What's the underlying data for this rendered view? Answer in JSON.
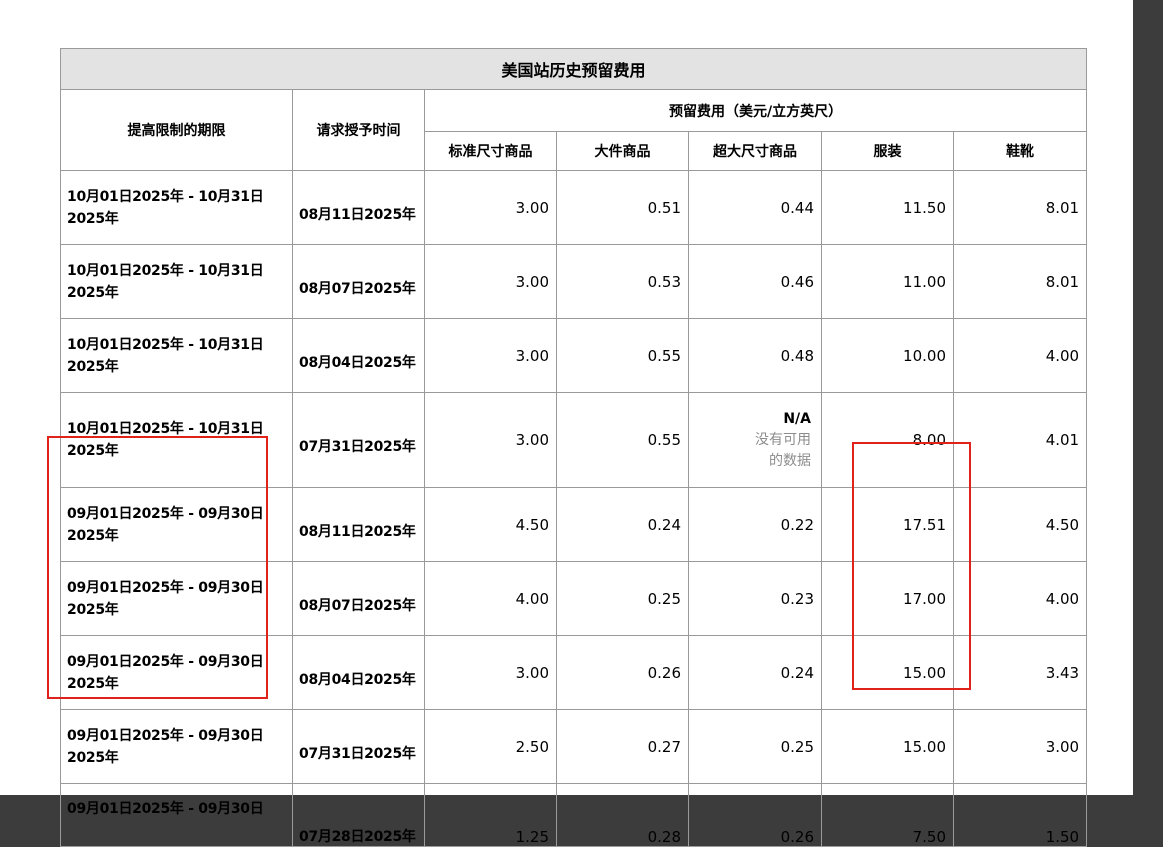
{
  "title": "美国站历史预留费用",
  "headers": {
    "period": "提高限制的期限",
    "request_time": "请求授予时间",
    "fee_group": "预留费用（美元/立方英尺）",
    "categories": [
      "标准尺寸商品",
      "大件商品",
      "超大尺寸商品",
      "服装",
      "鞋靴"
    ]
  },
  "rows": [
    {
      "period_line1": "10月01日2025年 - 10月31日",
      "period_line2": "2025年",
      "request": "08月11日2025年",
      "standard": "3.00",
      "large": "0.51",
      "oversize": "0.44",
      "apparel": "11.50",
      "footwear": "8.01"
    },
    {
      "period_line1": "10月01日2025年 - 10月31日",
      "period_line2": "2025年",
      "request": "08月07日2025年",
      "standard": "3.00",
      "large": "0.53",
      "oversize": "0.46",
      "apparel": "11.00",
      "footwear": "8.01"
    },
    {
      "period_line1": "10月01日2025年 - 10月31日",
      "period_line2": "2025年",
      "request": "08月04日2025年",
      "standard": "3.00",
      "large": "0.55",
      "oversize": "0.48",
      "apparel": "10.00",
      "footwear": "4.00"
    },
    {
      "period_line1": "10月01日2025年 - 10月31日",
      "period_line2": "2025年",
      "request": "07月31日2025年",
      "standard": "3.00",
      "large": "0.55",
      "oversize_na": "N/A",
      "oversize_note1": "没有可用",
      "oversize_note2": "的数据",
      "apparel": "8.00",
      "footwear": "4.01"
    },
    {
      "period_line1": "09月01日2025年 - 09月30日",
      "period_line2": "2025年",
      "request": "08月11日2025年",
      "standard": "4.50",
      "large": "0.24",
      "oversize": "0.22",
      "apparel": "17.51",
      "footwear": "4.50"
    },
    {
      "period_line1": "09月01日2025年 - 09月30日",
      "period_line2": "2025年",
      "request": "08月07日2025年",
      "standard": "4.00",
      "large": "0.25",
      "oversize": "0.23",
      "apparel": "17.00",
      "footwear": "4.00"
    },
    {
      "period_line1": "09月01日2025年 - 09月30日",
      "period_line2": "2025年",
      "request": "08月04日2025年",
      "standard": "3.00",
      "large": "0.26",
      "oversize": "0.24",
      "apparel": "15.00",
      "footwear": "3.43"
    },
    {
      "period_line1": "09月01日2025年 - 09月30日",
      "period_line2": "2025年",
      "request": "07月31日2025年",
      "standard": "2.50",
      "large": "0.27",
      "oversize": "0.25",
      "apparel": "15.00",
      "footwear": "3.00"
    },
    {
      "period_line1": "09月01日2025年 - 09月30日",
      "period_line2": "",
      "request": "07月28日2025年",
      "standard": "1.25",
      "large": "0.28",
      "oversize": "0.26",
      "apparel": "7.50",
      "footwear": "1.50"
    }
  ],
  "highlight_color": "#e0221a"
}
